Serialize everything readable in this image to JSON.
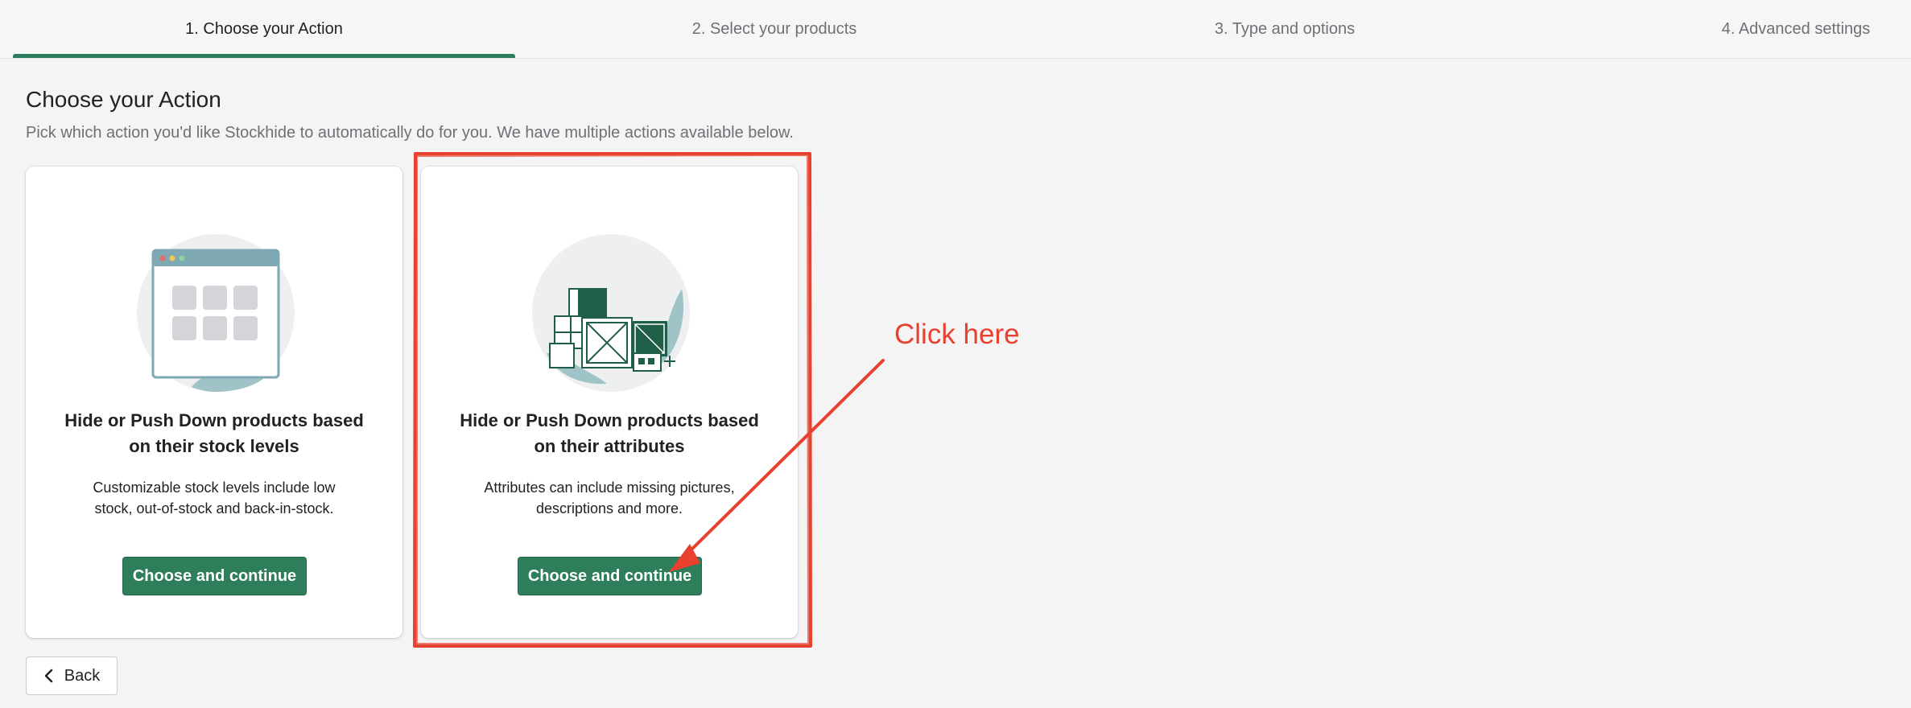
{
  "steps": [
    {
      "label": "1. Choose your Action",
      "active": true
    },
    {
      "label": "2. Select your products",
      "active": false
    },
    {
      "label": "3. Type and options",
      "active": false
    },
    {
      "label": "4. Advanced settings",
      "active": false
    }
  ],
  "header": {
    "title": "Choose your Action",
    "subtitle": "Pick which action you'd like Stockhide to automatically do for you. We have multiple actions available below."
  },
  "cards": [
    {
      "illustration": "browser-grid-illustration",
      "title_line1": "Hide or Push Down products based",
      "title_line2": "on their stock levels",
      "desc_line1": "Customizable stock levels include low",
      "desc_line2": "stock, out-of-stock and back-in-stock.",
      "button_label": "Choose and continue"
    },
    {
      "illustration": "boxes-illustration",
      "title_line1": "Hide or Push Down products based",
      "title_line2": "on their attributes",
      "desc_line1": "Attributes can include missing pictures,",
      "desc_line2": "descriptions and more.",
      "button_label": "Choose and continue"
    }
  ],
  "back_button": {
    "label": "Back",
    "icon": "chevron-left-icon"
  },
  "annotation": {
    "label": "Click here",
    "color": "#e8412f"
  },
  "colors": {
    "accent": "#2e7d5b",
    "tab_underline": "#2a7a5c",
    "background": "#f4f4f4",
    "annotation": "#e8412f"
  }
}
